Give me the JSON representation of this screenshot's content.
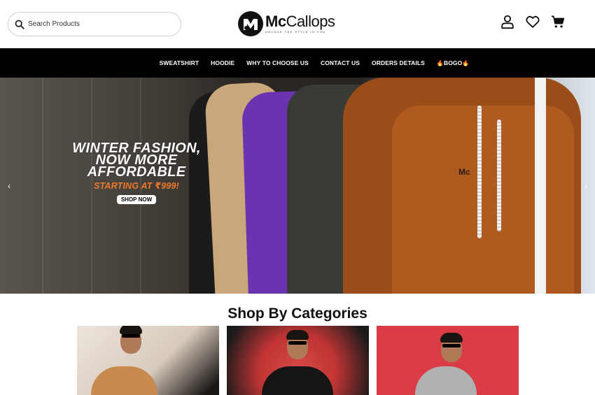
{
  "header": {
    "search_placeholder": "Search Products",
    "logo_brand_bold": "Mc",
    "logo_brand_regular": "Callops",
    "logo_tagline": "UNLOCK THE STYLE IN YOU",
    "icons": [
      "account-icon",
      "wishlist-heart-icon",
      "cart-icon"
    ]
  },
  "nav": {
    "items": [
      "SWEATSHIRT",
      "HOODIE",
      "WHY TO CHOOSE US",
      "CONTACT US",
      "ORDERS DETAILS",
      "BOGO"
    ],
    "bogo_emoji": "🔥"
  },
  "hero": {
    "line1": "WINTER FASHION,",
    "line2": "NOW MORE",
    "line3": "AFFORDABLE",
    "price": "STARTING AT ₹999!",
    "cta": "SHOP NOW",
    "print_text": "Mc",
    "arrow_left": "‹",
    "arrow_right": "›"
  },
  "categories": {
    "title": "Shop By Categories"
  },
  "colors": {
    "nav_bg": "#000000",
    "accent_orange": "#f07a2a"
  }
}
